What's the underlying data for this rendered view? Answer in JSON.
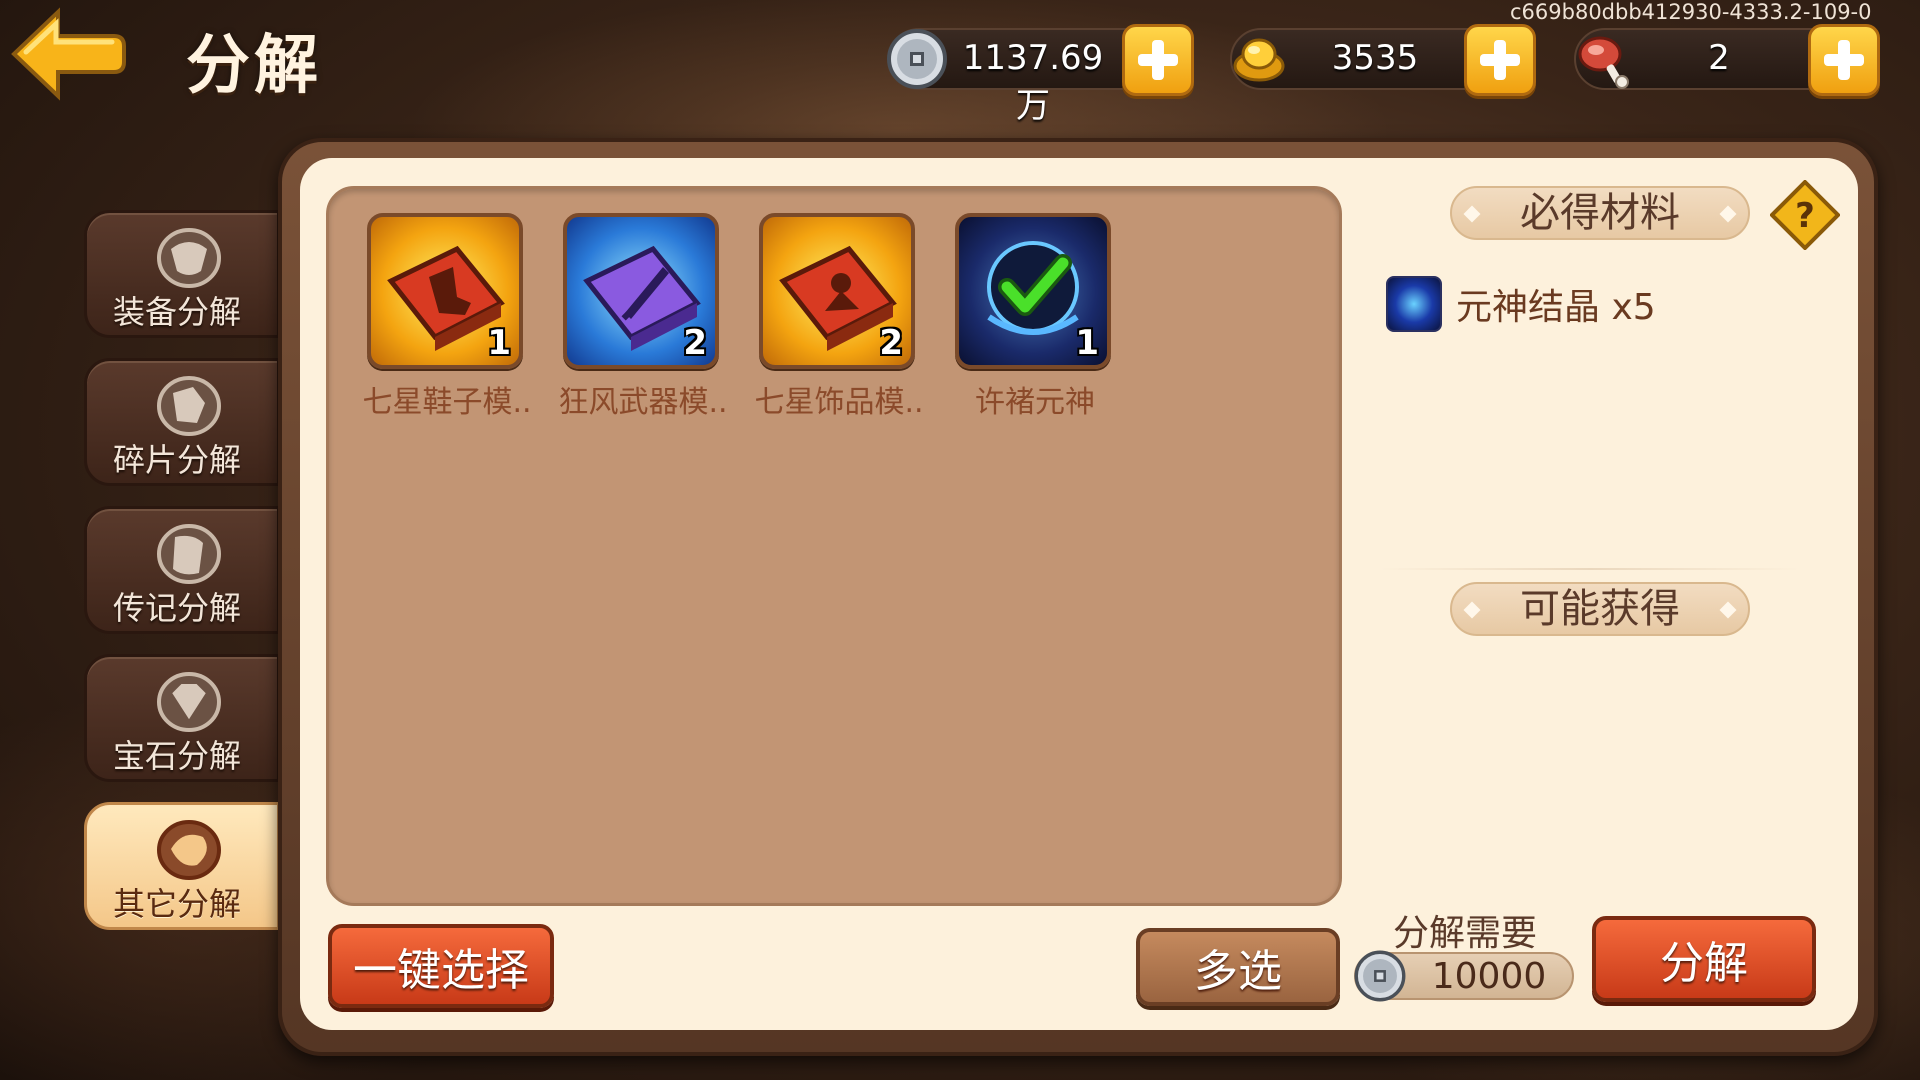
{
  "header": {
    "title": "分解",
    "device_id": "c669b80dbb412930-4333.2-109-0"
  },
  "resources": [
    {
      "name": "silver-coin",
      "value": "1137.69万"
    },
    {
      "name": "gold-ingot",
      "value": "3535"
    },
    {
      "name": "meat",
      "value": "2"
    }
  ],
  "side_tabs": [
    {
      "label": "装备分解",
      "active": false
    },
    {
      "label": "碎片分解",
      "active": false
    },
    {
      "label": "传记分解",
      "active": false
    },
    {
      "label": "宝石分解",
      "active": false
    },
    {
      "label": "其它分解",
      "active": true
    }
  ],
  "items": [
    {
      "name": "七星鞋子模..",
      "count": "1",
      "icon": "red-boot-scroll-icon"
    },
    {
      "name": "狂风武器模..",
      "count": "2",
      "icon": "purple-sword-scroll-icon"
    },
    {
      "name": "七星饰品模..",
      "count": "2",
      "icon": "red-accessory-scroll-icon"
    },
    {
      "name": "许褚元神",
      "count": "1",
      "icon": "spirit-checkmark-icon"
    }
  ],
  "right_panel": {
    "guaranteed_header": "必得材料",
    "guaranteed_material": "元神结晶 x5",
    "possible_header": "可能获得"
  },
  "footer": {
    "auto_select_label": "一键选择",
    "multi_select_label": "多选",
    "cost_label": "分解需要",
    "cost_value": "10000",
    "decompose_label": "分解"
  },
  "colors": {
    "accent_gold": "#f0a010",
    "button_red": "#c83a18",
    "panel_bg": "#fdf1dc",
    "item_area_bg": "#c29574"
  }
}
